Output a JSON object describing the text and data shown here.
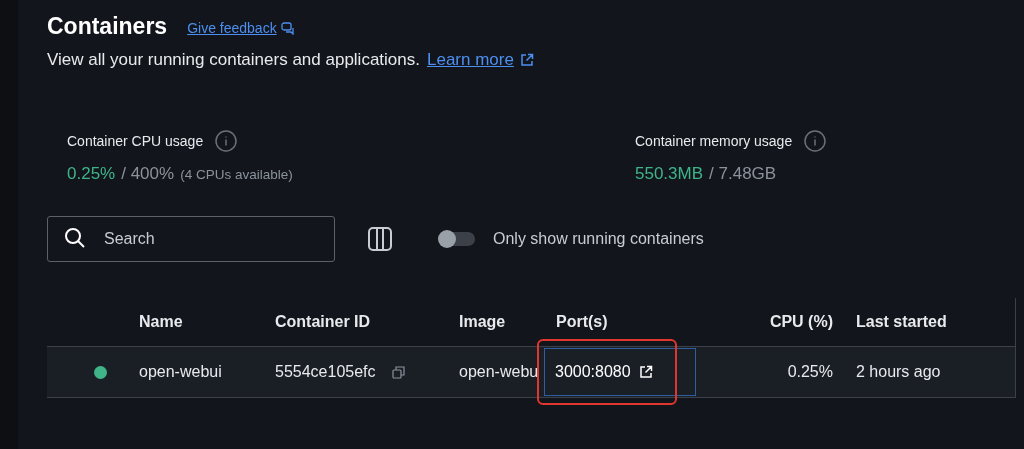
{
  "header": {
    "title": "Containers",
    "feedback_link": "Give feedback",
    "description": "View all your running containers and applications.",
    "learn_more_link": "Learn more"
  },
  "stats": [
    {
      "label": "Container CPU usage",
      "used": "0.25%",
      "total": "/ 400%",
      "note": "(4 CPUs available)"
    },
    {
      "label": "Container memory usage",
      "used": "550.3MB",
      "total": "/ 7.48GB"
    }
  ],
  "toolbar": {
    "search": {
      "placeholder": "Search"
    },
    "running_only": {
      "label": "Only show running containers",
      "on": false
    }
  },
  "table": {
    "columns": [
      "Name",
      "Container ID",
      "Image",
      "Port(s)",
      "CPU (%)",
      "Last started"
    ],
    "rows": [
      {
        "running": true,
        "name": "open-webui",
        "container_id": "5554ce105efc",
        "image": "open-webu",
        "ports": "3000:8080",
        "ports_highlighted": true,
        "cpu": "0.25%",
        "last_started": "2 hours ago"
      }
    ]
  }
}
